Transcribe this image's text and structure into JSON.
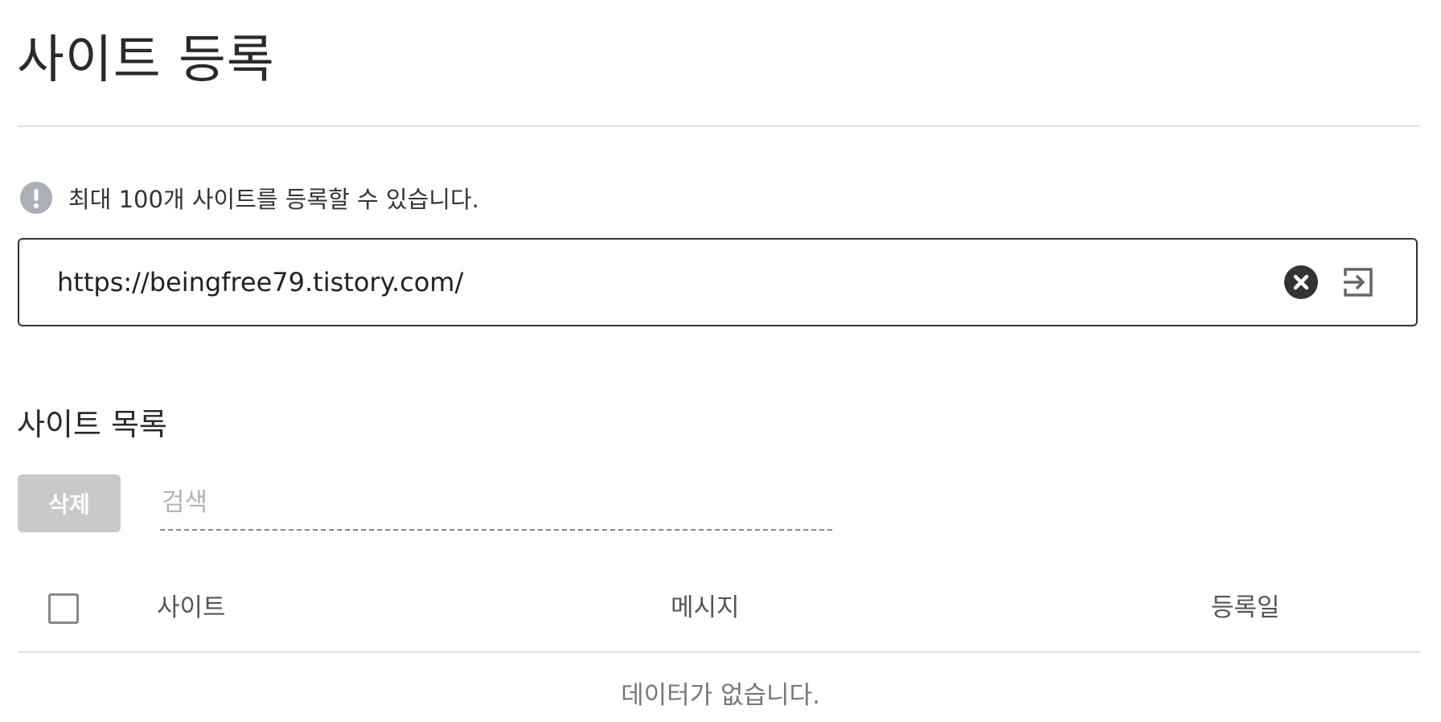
{
  "page": {
    "title": "사이트 등록"
  },
  "notice": {
    "icon": "exclamation-icon",
    "text": "최대 100개 사이트를 등록할 수 있습니다."
  },
  "url_field": {
    "value": "https://beingfree79.tistory.com/",
    "clear_icon": "close-circle-icon",
    "submit_icon": "enter-arrow-icon"
  },
  "site_list": {
    "title": "사이트 목록",
    "delete_label": "삭제",
    "search_placeholder": "검색",
    "columns": {
      "site": "사이트",
      "message": "메시지",
      "date": "등록일"
    },
    "empty_text": "데이터가 없습니다.",
    "rows": []
  },
  "colors": {
    "info_icon": "#a9b0b8",
    "delete_button_disabled": "#c9c9c9",
    "border_dark": "#333333",
    "divider": "#e0e0e0"
  }
}
